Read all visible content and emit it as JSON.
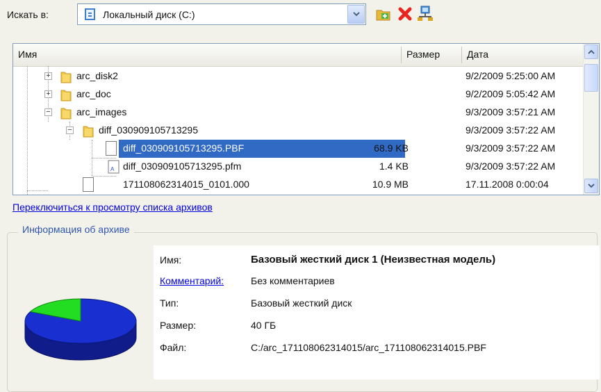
{
  "toolbar": {
    "look_in_label": "Искать в:",
    "drive_combo_value": "Локальный диск (C:)",
    "icons": [
      "new-folder-icon",
      "delete-icon",
      "network-icon"
    ]
  },
  "file_list": {
    "columns": [
      "Имя",
      "Размер",
      "Дата"
    ],
    "rows": [
      {
        "name": "arc_disk2",
        "size": "",
        "date": "9/2/2009 5:25:00 AM",
        "type": "folder",
        "expander": "+"
      },
      {
        "name": "arc_doc",
        "size": "",
        "date": "9/2/2009 5:05:42 AM",
        "type": "folder",
        "expander": "+"
      },
      {
        "name": "arc_images",
        "size": "",
        "date": "9/3/2009 3:57:21 AM",
        "type": "folder",
        "expander": "−"
      },
      {
        "name": "diff_030909105713295",
        "size": "",
        "date": "9/3/2009 3:57:22 AM",
        "type": "folder",
        "expander": "−"
      },
      {
        "name": "diff_030909105713295.PBF",
        "size": "68.9 KB",
        "date": "9/3/2009 3:57:22 AM",
        "type": "file",
        "selected": true
      },
      {
        "name": "diff_030909105713295.pfm",
        "size": "1.4 KB",
        "date": "9/3/2009 3:57:22 AM",
        "type": "file"
      }
    ],
    "partial_row": {
      "name": "171108062314015_0101.000",
      "size": "10.9 MB",
      "date": "17.11.2008 0:00:04"
    }
  },
  "switch_link": "Переключиться к просмотру списка архивов",
  "archive_info": {
    "group_title": "Информация об архиве",
    "name_label": "Имя:",
    "name_value": "Базовый жесткий диск 1 (Неизвестная модель)",
    "comment_label": "Комментарий:",
    "comment_value": "Без комментариев",
    "type_label": "Тип:",
    "type_value": "Базовый жесткий диск",
    "size_label": "Размер:",
    "size_value": "40 ГБ",
    "file_label": "Файл:",
    "file_value": "C:/arc_171108062314015/arc_171108062314015.PBF",
    "disk_usage": {
      "used_fraction": 0.18,
      "used_color": "#22dd22",
      "free_color": "#1a2fd0"
    }
  },
  "colors": {
    "selection": "#316ac5",
    "link": "#0000e0",
    "group_title": "#2e55b0"
  }
}
